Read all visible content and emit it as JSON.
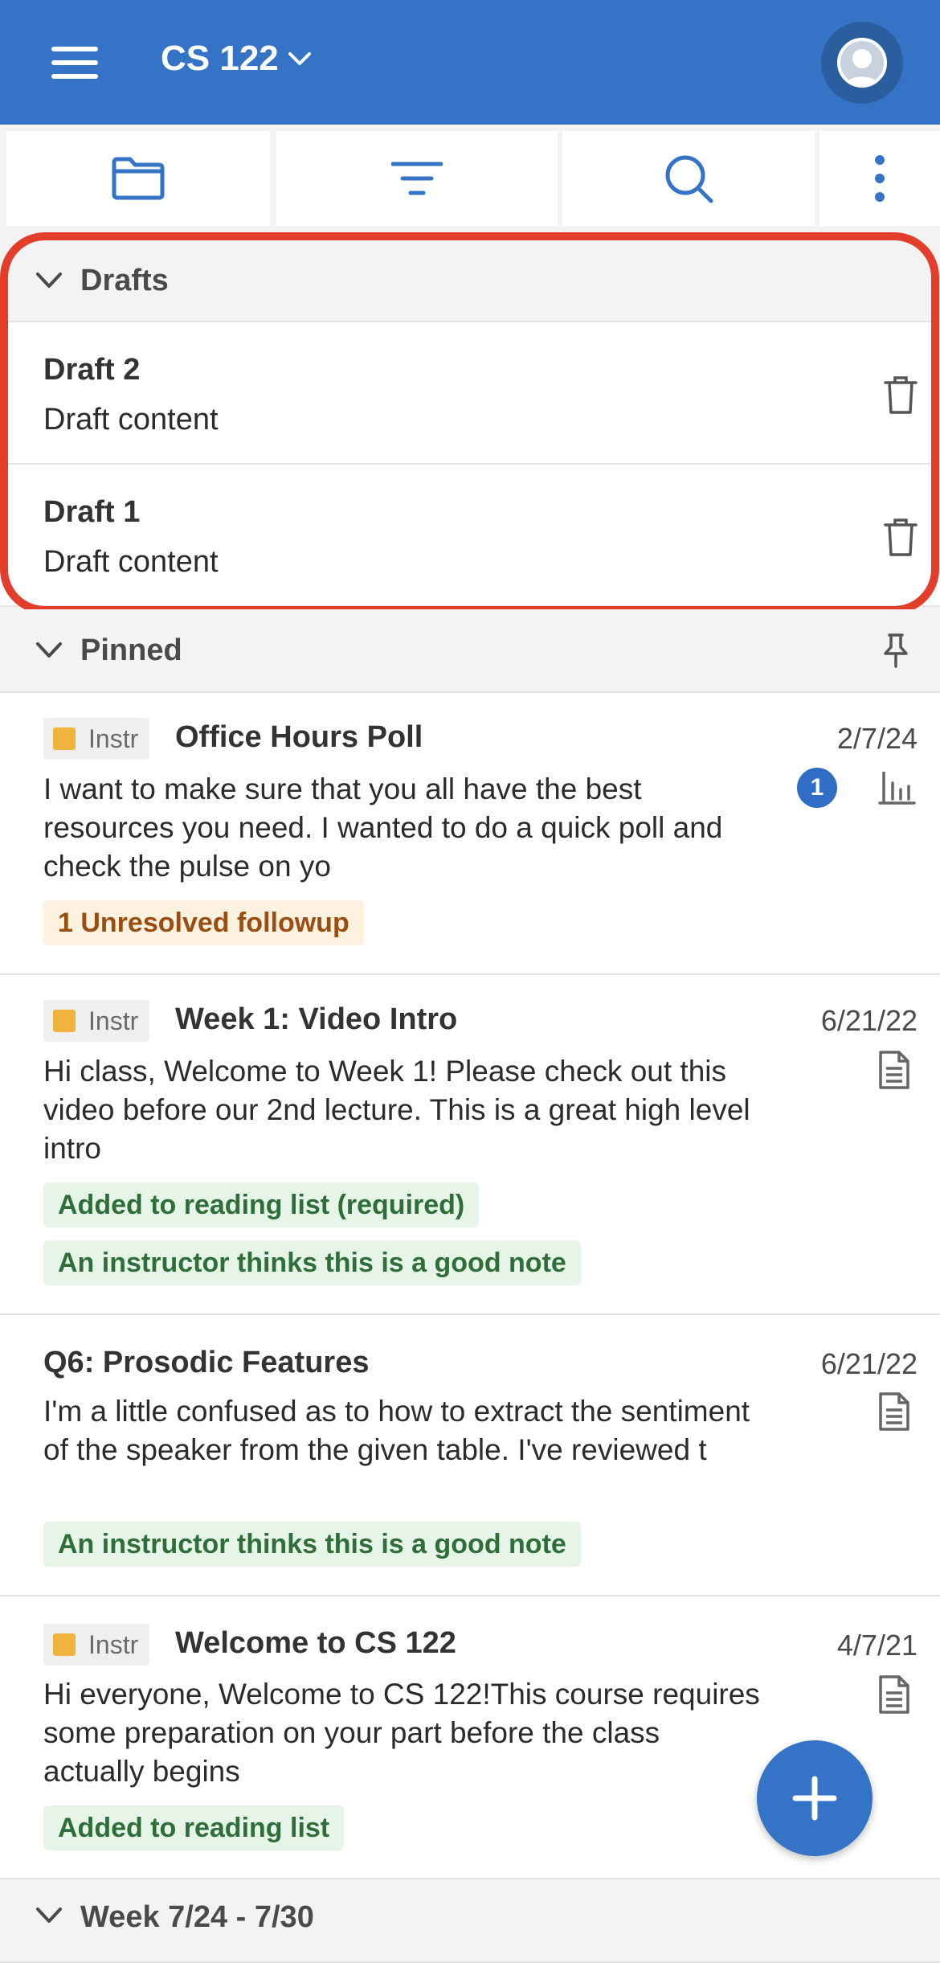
{
  "header": {
    "course": "CS 122"
  },
  "toolbar": {
    "items": [
      {
        "name": "folder-icon"
      },
      {
        "name": "filter-icon"
      },
      {
        "name": "search-icon"
      },
      {
        "name": "more-vertical-icon"
      }
    ]
  },
  "drafts": {
    "label": "Drafts",
    "items": [
      {
        "title": "Draft 2",
        "content": "Draft content"
      },
      {
        "title": "Draft 1",
        "content": "Draft content"
      }
    ]
  },
  "pinned": {
    "label": "Pinned",
    "posts": [
      {
        "badge": "Instr",
        "title": "Office Hours Poll",
        "date": "2/7/24",
        "body": "I want to make sure that you all have the best resources you need. I wanted to do a quick poll and check the pulse on yo",
        "count": "1",
        "tags": [
          "1 Unresolved followup"
        ],
        "icon": "poll-icon"
      },
      {
        "badge": "Instr",
        "title": "Week 1: Video Intro",
        "date": "6/21/22",
        "body": "Hi class,  Welcome to Week 1! Please check out this video before our 2nd lecture. This is a great high level intro",
        "tags": [
          "Added to reading list (required)",
          "An instructor thinks this is a good note"
        ],
        "icon": "note-icon"
      },
      {
        "title": "Q6: Prosodic Features",
        "date": "6/21/22",
        "body": "I'm a little confused as to how to extract the sentiment of the speaker from the given table.  I've reviewed t",
        "tags": [
          "An instructor thinks this is a good note"
        ],
        "icon": "note-icon"
      },
      {
        "badge": "Instr",
        "title": "Welcome to CS 122",
        "date": "4/7/21",
        "body": "Hi everyone, Welcome to CS 122!This course requires some preparation on your part before the class actually begins",
        "tags": [
          "Added to reading list"
        ],
        "icon": "note-icon"
      }
    ]
  },
  "next_section": {
    "label": "Week 7/24 - 7/30"
  },
  "colors": {
    "brand": "#3473c6",
    "highlight": "#e33d2b",
    "instr_badge": "#f0b43c"
  }
}
